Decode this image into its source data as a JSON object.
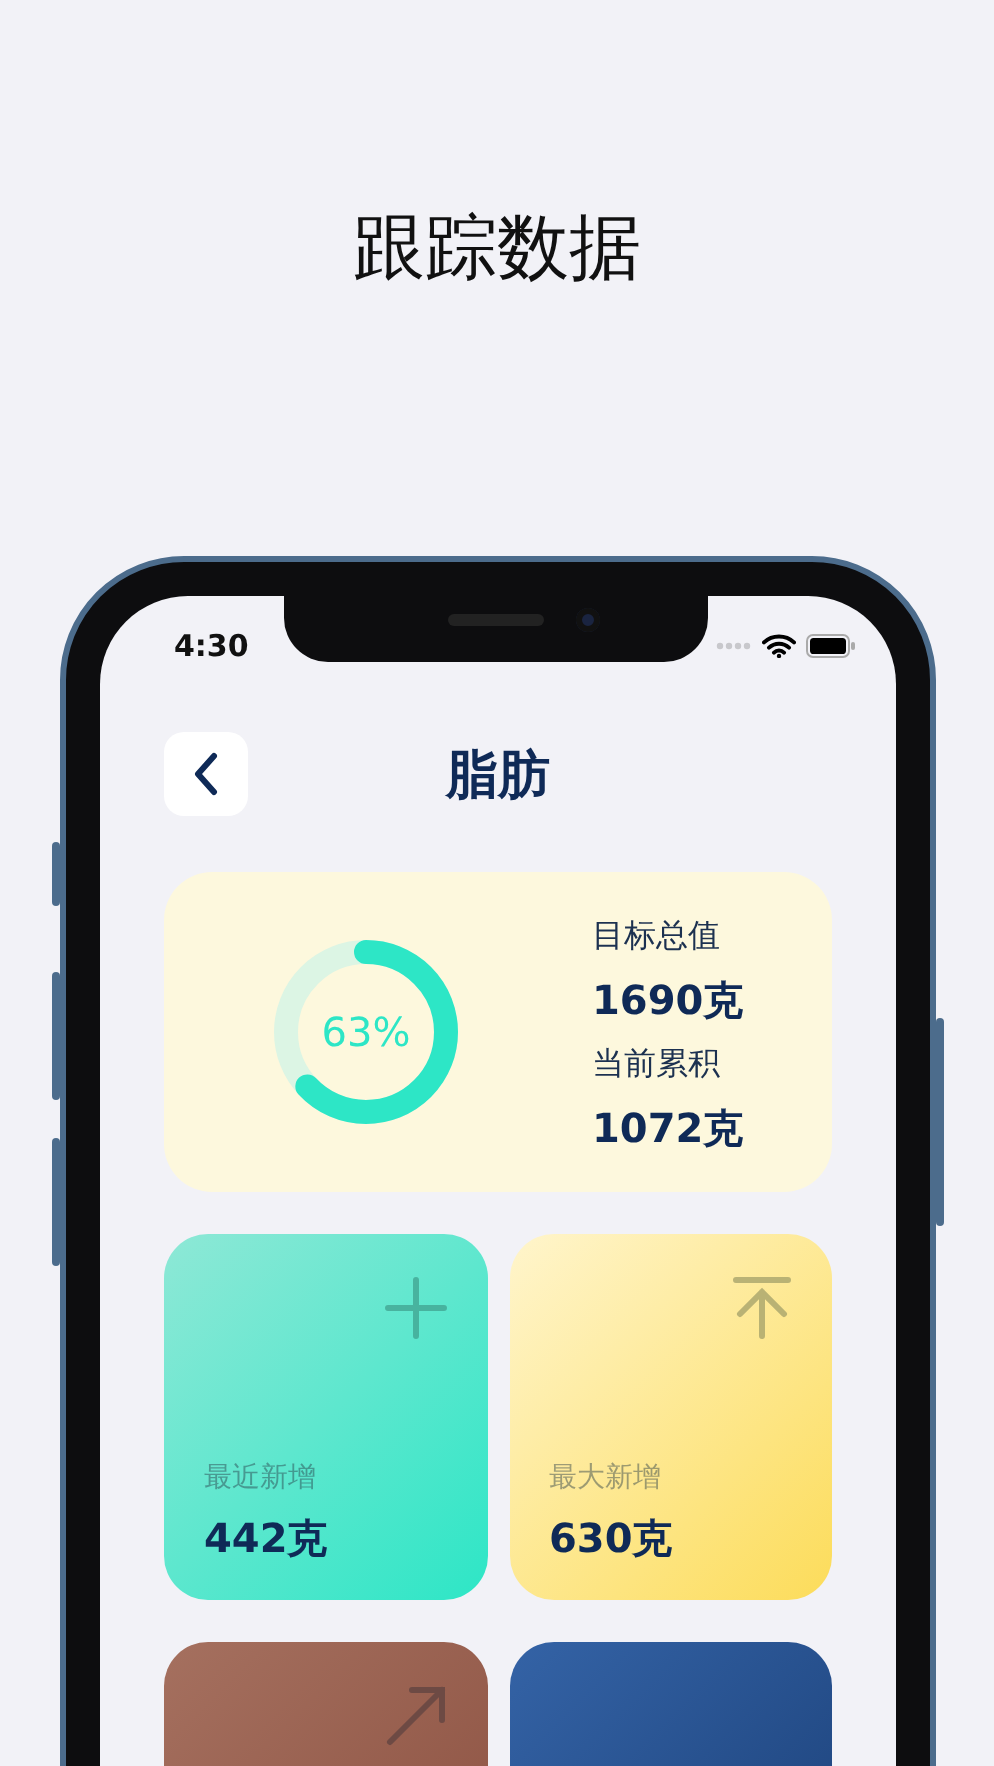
{
  "headline": "跟踪数据",
  "status_bar": {
    "time": "4:30"
  },
  "header": {
    "title": "脂肪"
  },
  "summary": {
    "level": 0.63,
    "percent": "63%",
    "stats": [
      {
        "label": "目标总值",
        "value": "1690克"
      },
      {
        "label": "当前累积",
        "value": "1072克"
      }
    ]
  },
  "tiles": [
    {
      "kind": "recent",
      "label": "最近新增",
      "value": "442克"
    },
    {
      "kind": "max",
      "label": "最大新增",
      "value": "630克"
    },
    {
      "kind": "trend"
    },
    {
      "kind": "other"
    }
  ]
}
